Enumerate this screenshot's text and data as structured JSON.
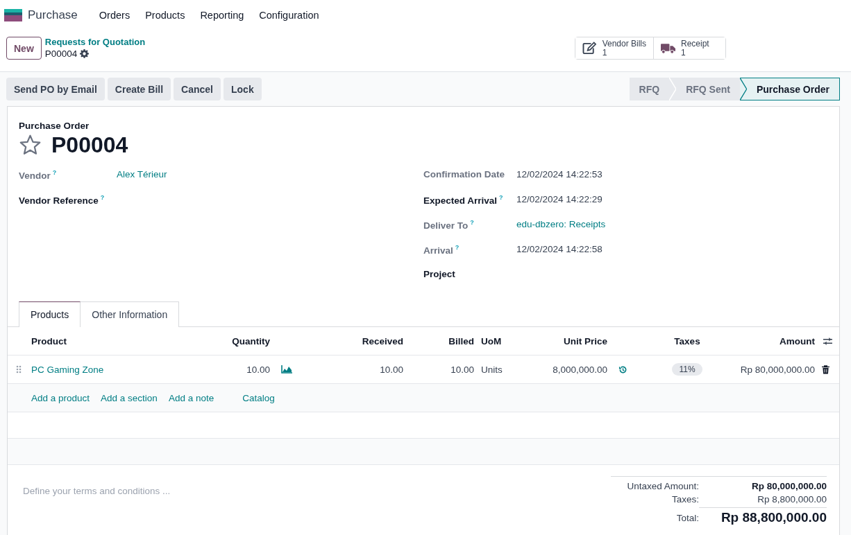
{
  "navbar": {
    "app_name": "Purchase",
    "menu": [
      "Orders",
      "Products",
      "Reporting",
      "Configuration"
    ]
  },
  "control_panel": {
    "new_button": "New",
    "breadcrumb": "Requests for Quotation",
    "record": "P00004",
    "smart_buttons": [
      {
        "kind": "bills",
        "label": "Vendor Bills",
        "count": "1"
      },
      {
        "kind": "receipt",
        "label": "Receipt",
        "count": "1"
      }
    ]
  },
  "actions": [
    "Send PO by Email",
    "Create Bill",
    "Cancel",
    "Lock"
  ],
  "statusbar": [
    {
      "label": "RFQ",
      "selected": false
    },
    {
      "label": "RFQ Sent",
      "selected": false
    },
    {
      "label": "Purchase Order",
      "selected": true
    }
  ],
  "form": {
    "subtitle": "Purchase Order",
    "name": "P00004",
    "starred": false,
    "left_fields": [
      {
        "label": "Vendor",
        "help": "?",
        "required": false,
        "value": "Alex Térieur",
        "link": true
      },
      {
        "label": "Vendor Reference",
        "help": "?",
        "required": true
      }
    ],
    "right_fields": [
      {
        "label": "Confirmation Date",
        "required": false,
        "value": "12/02/2024 14:22:53",
        "link": false
      },
      {
        "label": "Expected Arrival",
        "help": "?",
        "required": true,
        "value": "12/02/2024 14:22:29",
        "link": false
      },
      {
        "label": "Deliver To",
        "help": "?",
        "required": false,
        "value": "edu-dbzero: Receipts",
        "link": true
      },
      {
        "label": "Arrival",
        "help": "?",
        "required": false,
        "value": "12/02/2024 14:22:58",
        "link": false
      },
      {
        "label": "Project",
        "required": true
      }
    ]
  },
  "tabs": [
    {
      "label": "Products",
      "selected": true
    },
    {
      "label": "Other Information",
      "selected": false
    }
  ],
  "lines": {
    "columns": [
      "Product",
      "Quantity",
      "Received",
      "Billed",
      "UoM",
      "Unit Price",
      "Taxes",
      "Amount"
    ],
    "rows": [
      {
        "product": "PC Gaming Zone",
        "quantity": "10.00",
        "received": "10.00",
        "billed": "10.00",
        "uom": "Units",
        "unit_price": "8,000,000.00",
        "taxes": [
          "11%"
        ],
        "amount": "Rp 80,000,000.00"
      }
    ],
    "add_links": [
      "Add a product",
      "Add a section",
      "Add a note",
      "Catalog"
    ]
  },
  "terms": {
    "placeholder": "Define your terms and conditions ..."
  },
  "totals": [
    {
      "label": "Untaxed Amount:",
      "value": "Rp 80,000,000.00",
      "kind": "subtotal"
    },
    {
      "label": "Taxes:",
      "value": "Rp 8,800,000.00",
      "kind": "tax"
    },
    {
      "label": "Total:",
      "value": "Rp 88,800,000.00",
      "kind": "total"
    }
  ]
}
